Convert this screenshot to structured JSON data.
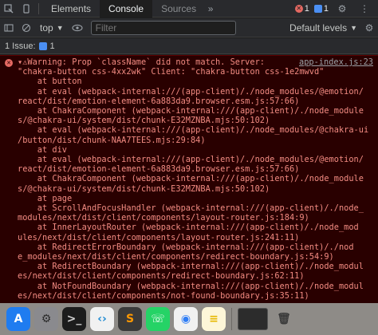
{
  "devtools": {
    "tabs": [
      {
        "label": "Elements"
      },
      {
        "label": "Console"
      },
      {
        "label": "Sources"
      }
    ],
    "error_count": "1",
    "message_count": "1",
    "context": "top",
    "filter_placeholder": "Filter",
    "levels_label": "Default levels",
    "issues_label": "1 Issue:",
    "issues_count": "1"
  },
  "console": {
    "source_link": "app-index.js:23",
    "lines": [
      "▾⚠Warning: Prop `className` did not match. Server:",
      "\"chakra-button css-4xx2wk\" Client: \"chakra-button css-1e2mwvd\"",
      "    at button",
      "    at eval (webpack-internal:///(app-client)/./node_modules/@emotion/",
      "react/dist/emotion-element-6a883da9.browser.esm.js:57:66)",
      "    at ChakraComponent (webpack-internal:///(app-client)/./node_module",
      "s/@chakra-ui/system/dist/chunk-E32MZNBA.mjs:50:102)",
      "    at eval (webpack-internal:///(app-client)/./node_modules/@chakra-ui",
      "/button/dist/chunk-NAA7TEES.mjs:29:84)",
      "    at div",
      "    at eval (webpack-internal:///(app-client)/./node_modules/@emotion/",
      "react/dist/emotion-element-6a883da9.browser.esm.js:57:66)",
      "    at ChakraComponent (webpack-internal:///(app-client)/./node_module",
      "s/@chakra-ui/system/dist/chunk-E32MZNBA.mjs:50:102)",
      "    at page",
      "    at ScrollAndFocusHandler (webpack-internal:///(app-client)/./node_",
      "modules/next/dist/client/components/layout-router.js:184:9)",
      "    at InnerLayoutRouter (webpack-internal:///(app-client)/./node_mod",
      "ules/next/dist/client/components/layout-router.js:241:11)",
      "    at RedirectErrorBoundary (webpack-internal:///(app-client)/./nod",
      "e_modules/next/dist/client/components/redirect-boundary.js:54:9)",
      "    at RedirectBoundary (webpack-internal:///(app-client)/./node_modul",
      "es/next/dist/client/components/redirect-boundary.js:62:11)",
      "    at NotFoundBoundary (webpack-internal:///(app-client)/./node_modul",
      "es/next/dist/client/components/not-found-boundary.js:35:11)"
    ]
  },
  "dock": {
    "apps": [
      {
        "icon": "app-store-icon",
        "glyph": "A",
        "bg": "#1f7cf0",
        "fg": "#ffffff"
      },
      {
        "icon": "system-settings-icon",
        "glyph": "⚙",
        "bg": "#8a8a8e",
        "fg": "#2b2b2b"
      },
      {
        "icon": "terminal-icon",
        "glyph": ">_",
        "bg": "#1c1c1c",
        "fg": "#d0d0d0"
      },
      {
        "icon": "vscode-icon",
        "glyph": "‹›",
        "bg": "#f1f1f1",
        "fg": "#1f8ad2"
      },
      {
        "icon": "sublime-text-icon",
        "glyph": "S",
        "bg": "#3a3a3a",
        "fg": "#ff9800"
      },
      {
        "icon": "whatsapp-icon",
        "glyph": "☏",
        "bg": "#25d366",
        "fg": "#ffffff"
      },
      {
        "icon": "chrome-icon",
        "glyph": "◉",
        "bg": "#f1f1f1",
        "fg": "#2f7df6"
      },
      {
        "icon": "notes-icon",
        "glyph": "≡",
        "bg": "#fdf6d8",
        "fg": "#e6b800"
      }
    ]
  }
}
